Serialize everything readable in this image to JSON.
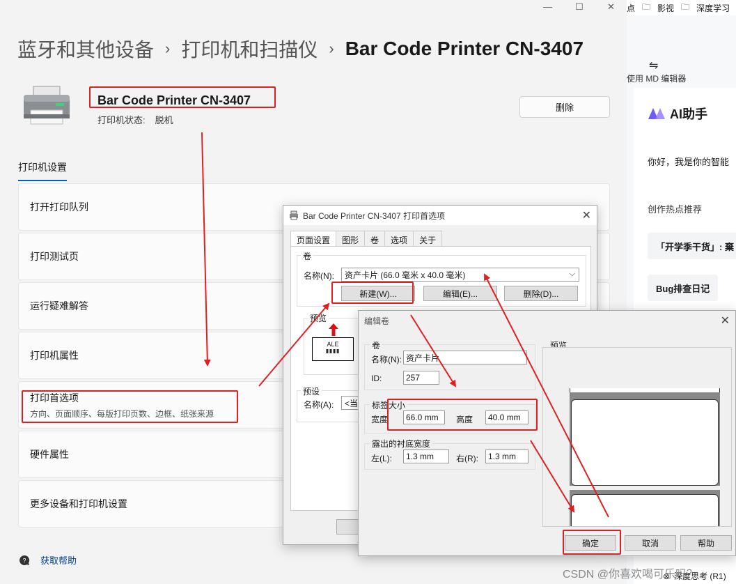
{
  "settings": {
    "breadcrumb": [
      "蓝牙和其他设备",
      "打印机和扫描仪",
      "Bar Code Printer CN-3407"
    ],
    "printer_name": "Bar Code Printer CN-3407",
    "status_label": "打印机状态:",
    "status_value": "脱机",
    "delete_button": "删除",
    "section_tab": "打印机设置",
    "items": [
      {
        "label": "打开打印队列",
        "desc": ""
      },
      {
        "label": "打印测试页",
        "desc": ""
      },
      {
        "label": "运行疑难解答",
        "desc": ""
      },
      {
        "label": "打印机属性",
        "desc": ""
      },
      {
        "label": "打印首选项",
        "desc": "方向、页面顺序、每版打印页数、边框、纸张来源"
      },
      {
        "label": "硬件属性",
        "desc": ""
      },
      {
        "label": "更多设备和打印机设置",
        "desc": ""
      }
    ],
    "help_link": "获取帮助",
    "window_controls": [
      "—",
      "☐",
      "✕"
    ]
  },
  "browser": {
    "bookmarks": [
      "点",
      "影视",
      "深度学习"
    ],
    "md_editor": "使用 MD 编辑器",
    "ai_title": "AI助手",
    "ai_greeting": "你好，我是你的智能",
    "hot_topics": "创作热点推荐",
    "chip1": "「开学季干货」: 棄",
    "chip2": "Bug排查日记",
    "bottom_text": "深度思考 (R1)"
  },
  "prefs_dialog": {
    "title": "Bar Code Printer CN-3407 打印首选项",
    "tabs": [
      "页面设置",
      "图形",
      "卷",
      "选项",
      "关于"
    ],
    "roll_group": "卷",
    "name_label": "名称(N):",
    "roll_name": "资产卡片 (66.0 毫米 x 40.0 毫米)",
    "new_button": "新建(W)...",
    "edit_button": "编辑(E)...",
    "delete_button": "删除(D)...",
    "preview_group": "预览",
    "preview_label": "ALE",
    "preset_group": "预设",
    "preset_name_label": "名称(A):",
    "preset_value": "<当前"
  },
  "edit_roll_dialog": {
    "title": "编辑卷",
    "roll_group": "卷",
    "name_label": "名称(N):",
    "name_value": "资产卡片",
    "id_label": "ID:",
    "id_value": "257",
    "label_size_group": "标签大小",
    "width_label": "宽度",
    "width_value": "66.0 mm",
    "height_label": "高度",
    "height_value": "40.0 mm",
    "liner_group": "露出的衬底宽度",
    "left_label": "左(L):",
    "left_value": "1.3 mm",
    "right_label": "右(R):",
    "right_value": "1.3 mm",
    "preview_group": "预览",
    "ok_button": "确定",
    "cancel_button": "取消",
    "help_button": "帮助"
  },
  "watermark": "CSDN @你喜欢喝可乐吗？",
  "colors": {
    "annotation_red": "#e02020",
    "accent_blue": "#005fb8"
  }
}
